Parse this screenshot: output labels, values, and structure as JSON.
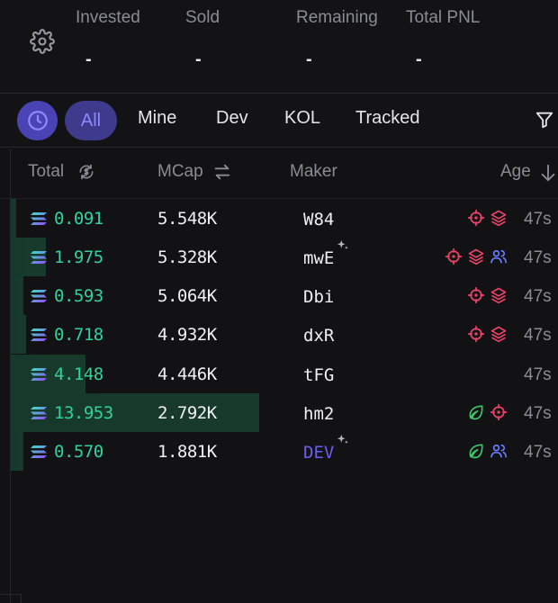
{
  "summary": {
    "invested_label": "Invested",
    "sold_label": "Sold",
    "remaining_label": "Remaining",
    "total_pnl_label": "Total PNL",
    "invested_value": "-",
    "sold_value": "-",
    "remaining_value": "-",
    "total_pnl_value": "-"
  },
  "tabs": [
    "All",
    "Mine",
    "Dev",
    "KOL",
    "Tracked"
  ],
  "active_tab": "All",
  "columns": {
    "total": "Total",
    "mcap": "MCap",
    "maker": "Maker",
    "age": "Age"
  },
  "rows": [
    {
      "total": "0.091",
      "mcap": "5.548K",
      "maker": "W84",
      "age": "47s",
      "bar_fraction": 0.02,
      "sparkle": false,
      "is_dev": false,
      "icons": [
        "target-icon",
        "layers-icon"
      ]
    },
    {
      "total": "1.975",
      "mcap": "5.328K",
      "maker": "mwE",
      "age": "47s",
      "bar_fraction": 0.14,
      "sparkle": true,
      "is_dev": false,
      "icons": [
        "target-icon",
        "layers-icon",
        "users-icon"
      ]
    },
    {
      "total": "0.593",
      "mcap": "5.064K",
      "maker": "Dbi",
      "age": "47s",
      "bar_fraction": 0.05,
      "sparkle": false,
      "is_dev": false,
      "icons": [
        "target-icon",
        "layers-icon"
      ]
    },
    {
      "total": "0.718",
      "mcap": "4.932K",
      "maker": "dxR",
      "age": "47s",
      "bar_fraction": 0.06,
      "sparkle": false,
      "is_dev": false,
      "icons": [
        "target-icon",
        "layers-icon"
      ]
    },
    {
      "total": "4.148",
      "mcap": "4.446K",
      "maker": "tFG",
      "age": "47s",
      "bar_fraction": 0.3,
      "sparkle": false,
      "is_dev": false,
      "icons": []
    },
    {
      "total": "13.953",
      "mcap": "2.792K",
      "maker": "hm2",
      "age": "47s",
      "bar_fraction": 1.0,
      "sparkle": false,
      "is_dev": false,
      "icons": [
        "leaf-icon",
        "target-icon"
      ]
    },
    {
      "total": "0.570",
      "mcap": "1.881K",
      "maker": "DEV",
      "age": "47s",
      "bar_fraction": 0.05,
      "sparkle": true,
      "is_dev": true,
      "icons": [
        "leaf-icon",
        "users-icon"
      ]
    }
  ],
  "colors": {
    "accent": "#5b52e0",
    "positive": "#2fd39a",
    "danger": "#f0436b",
    "users": "#6b7cff",
    "leaf": "#3cc76a"
  }
}
